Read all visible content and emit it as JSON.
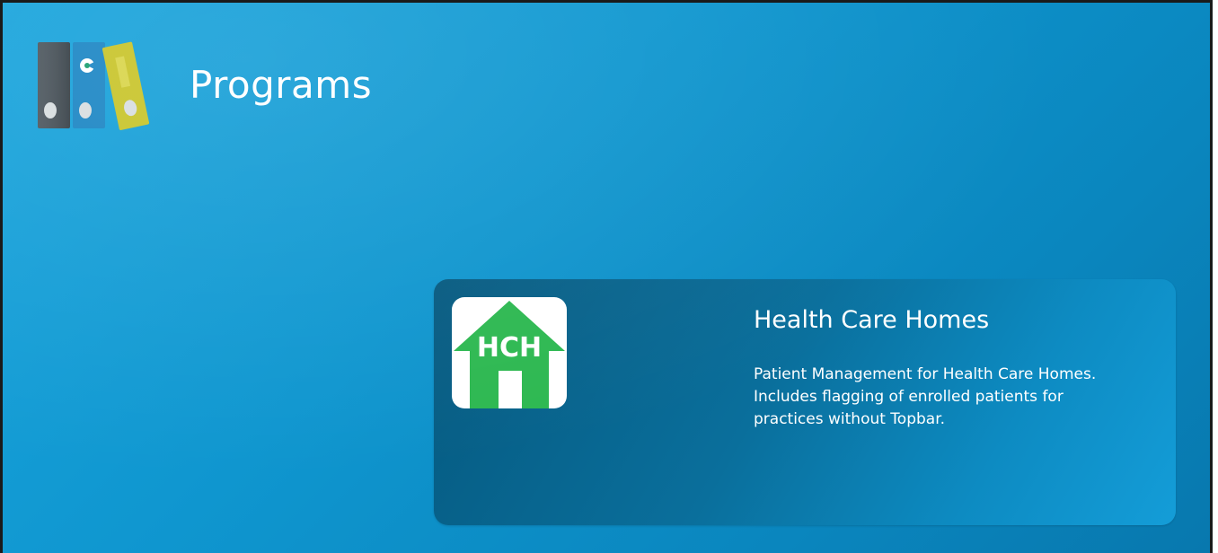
{
  "header": {
    "title": "Programs",
    "logo_icon": "programs-binders-icon"
  },
  "programs": [
    {
      "title": "Health Care Homes",
      "description": "Patient Management for Health Care Homes. Includes flagging of enrolled patients for practices without Topbar.",
      "icon": "house-icon",
      "icon_text": "HCH",
      "icon_color": "#2db851"
    }
  ],
  "colors": {
    "background": "#0f96cf",
    "tile": "#0a6f9c",
    "text": "#ffffff"
  }
}
